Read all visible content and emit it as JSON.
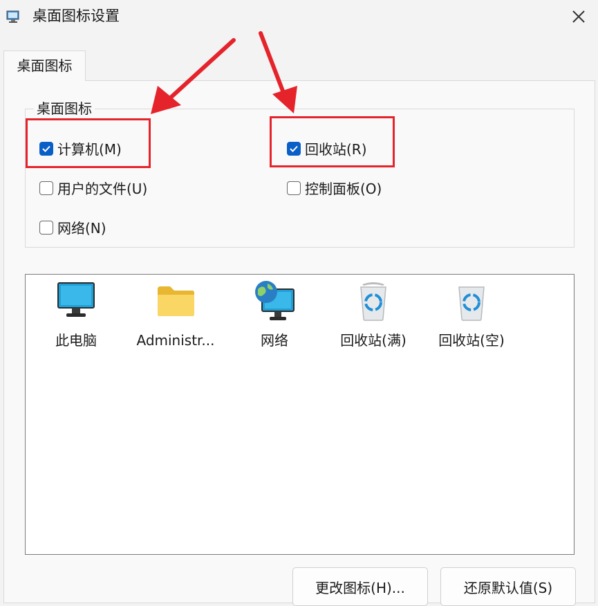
{
  "window": {
    "title": "桌面图标设置"
  },
  "tab": {
    "label": "桌面图标"
  },
  "group": {
    "label": "桌面图标",
    "checkboxes": [
      {
        "label": "计算机(M)",
        "checked": true
      },
      {
        "label": "回收站(R)",
        "checked": true
      },
      {
        "label": "用户的文件(U)",
        "checked": false
      },
      {
        "label": "控制面板(O)",
        "checked": false
      },
      {
        "label": "网络(N)",
        "checked": false
      }
    ]
  },
  "icons": [
    {
      "label": "此电脑",
      "icon": "monitor-icon"
    },
    {
      "label": "Administr...",
      "icon": "folder-icon"
    },
    {
      "label": "网络",
      "icon": "network-globe-icon"
    },
    {
      "label": "回收站(满)",
      "icon": "recycle-bin-full-icon"
    },
    {
      "label": "回收站(空)",
      "icon": "recycle-bin-empty-icon"
    }
  ],
  "buttons": {
    "change_icon": "更改图标(H)...",
    "restore_default": "还原默认值(S)"
  },
  "colors": {
    "accent": "#0a5fc7",
    "annotation": "#e5232b"
  }
}
